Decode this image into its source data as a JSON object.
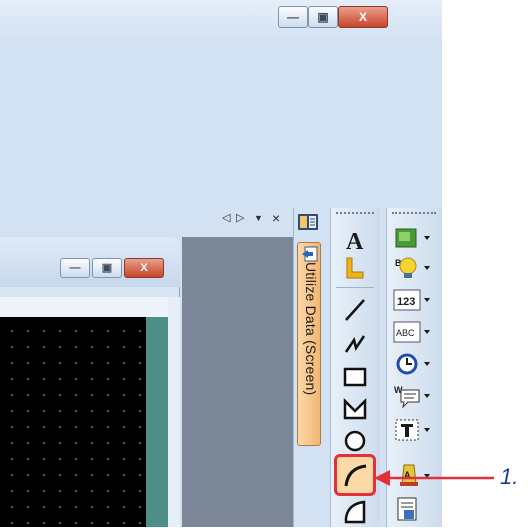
{
  "window_controls": {
    "minimize_glyph": "—",
    "restore_glyph": "▣",
    "close_glyph": "X"
  },
  "panel_header": {
    "prev_glyph": "◁",
    "next_glyph": "▷",
    "menu_glyph": "▼",
    "close_glyph": "×"
  },
  "inner_window_controls": {
    "minimize_glyph": "—",
    "restore_glyph": "▣",
    "close_glyph": "X"
  },
  "side_tab": {
    "label": "Utilize Data (Screen)"
  },
  "toolbar_figures": {
    "tools": [
      "text-tool",
      "line-freeform-tool",
      "line-tool",
      "polyline-tool",
      "rectangle-tool",
      "polygon-tool",
      "circle-tool",
      "arc-tool",
      "sector-tool"
    ]
  },
  "toolbar_objects": {
    "tools": [
      "switch-tool",
      "lamp-tool",
      "numerical-display-tool",
      "ascii-display-tool",
      "clock-tool",
      "comment-tool",
      "parts-tool",
      "alarm-tool",
      "data-list-tool"
    ],
    "numerical_label": "123",
    "ascii_label": "ABC"
  },
  "callout": {
    "number": "1.",
    "color": "#1c3f94",
    "arrow_color": "#e0303a"
  },
  "colors": {
    "highlight_border": "#e0303a",
    "tab_orange": "#f3b672",
    "canvas": "#000000"
  }
}
